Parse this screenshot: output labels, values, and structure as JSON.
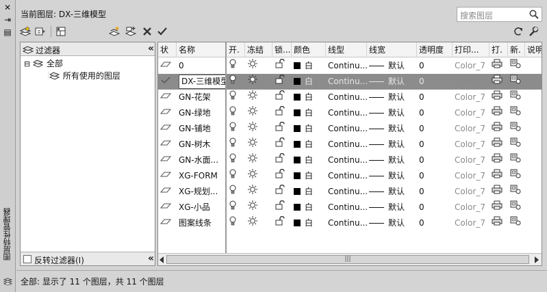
{
  "window": {
    "title": "图层特性管理器",
    "close_glyph": "✕",
    "pin_glyph": "⇥",
    "props_glyph": "▤"
  },
  "header": {
    "current_layer_label": "当前图层: DX-三维模型",
    "search_placeholder": "搜索图层"
  },
  "filter_panel": {
    "title": "过滤器",
    "tree": [
      {
        "label": "全部",
        "expander": "⊟"
      },
      {
        "label": "所有使用的图层"
      }
    ],
    "invert_label": "反转过滤器(I)",
    "invert_checked": false,
    "collapse_glyph": "«"
  },
  "columns": [
    "状",
    "名称",
    "开.",
    "冻结",
    "锁...",
    "颜色",
    "线型",
    "线宽",
    "透明度",
    "打印...",
    "打.",
    "新.",
    "说明"
  ],
  "layers": [
    {
      "name": "0",
      "color": "白",
      "linetype": "Continu...",
      "lineweight": "默认",
      "transparency": "0",
      "plot_style": "Color_7",
      "current": false
    },
    {
      "name": "DX-三维模型",
      "color": "白",
      "linetype": "Continu...",
      "lineweight": "默认",
      "transparency": "0",
      "plot_style": "Color_7",
      "current": true
    },
    {
      "name": "GN-花架",
      "color": "白",
      "linetype": "Continu...",
      "lineweight": "默认",
      "transparency": "0",
      "plot_style": "Color_7",
      "current": false
    },
    {
      "name": "GN-绿地",
      "color": "白",
      "linetype": "Continu...",
      "lineweight": "默认",
      "transparency": "0",
      "plot_style": "Color_7",
      "current": false
    },
    {
      "name": "GN-铺地",
      "color": "白",
      "linetype": "Continu...",
      "lineweight": "默认",
      "transparency": "0",
      "plot_style": "Color_7",
      "current": false
    },
    {
      "name": "GN-树木",
      "color": "白",
      "linetype": "Continu...",
      "lineweight": "默认",
      "transparency": "0",
      "plot_style": "Color_7",
      "current": false
    },
    {
      "name": "GN-水面...",
      "color": "白",
      "linetype": "Continu...",
      "lineweight": "默认",
      "transparency": "0",
      "plot_style": "Color_7",
      "current": false
    },
    {
      "name": "XG-FORM",
      "color": "白",
      "linetype": "Continu...",
      "lineweight": "默认",
      "transparency": "0",
      "plot_style": "Color_7",
      "current": false
    },
    {
      "name": "XG-规划...",
      "color": "白",
      "linetype": "Continu...",
      "lineweight": "默认",
      "transparency": "0",
      "plot_style": "Color_7",
      "current": false
    },
    {
      "name": "XG-小品",
      "color": "白",
      "linetype": "Continu...",
      "lineweight": "默认",
      "transparency": "0",
      "plot_style": "Color_7",
      "current": false
    },
    {
      "name": "图案线条",
      "color": "白",
      "linetype": "Continu...",
      "lineweight": "默认",
      "transparency": "0",
      "plot_style": "Color_7",
      "current": false
    }
  ],
  "scrollbar": {
    "thumb_glyph": "|||"
  },
  "status": {
    "text": "全部: 显示了 11 个图层，共 11 个图层"
  },
  "colors": {
    "selected_row": "#8c8c8c",
    "panel_bg": "#d4d4d4",
    "icon_yellow": "#e8c000"
  }
}
